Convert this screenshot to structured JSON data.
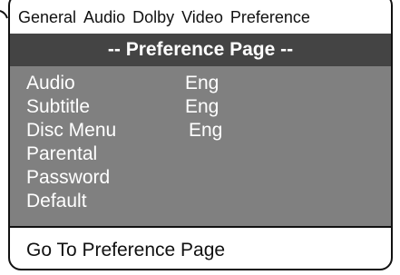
{
  "tabs": [
    "General",
    "Audio",
    "Dolby",
    "Video",
    "Preference"
  ],
  "page_title": "-- Preference Page --",
  "menu": [
    {
      "label": "Audio",
      "value": "Eng"
    },
    {
      "label": "Subtitle",
      "value": "Eng"
    },
    {
      "label": "Disc Menu",
      "value": "Eng"
    },
    {
      "label": "Parental",
      "value": ""
    },
    {
      "label": "Password",
      "value": ""
    },
    {
      "label": "Default",
      "value": ""
    }
  ],
  "status_text": "Go To Preference Page",
  "colors": {
    "title_bar": "#444444",
    "menu_panel": "#808080",
    "text_on_dark": "#ffffff",
    "border": "#111111"
  }
}
